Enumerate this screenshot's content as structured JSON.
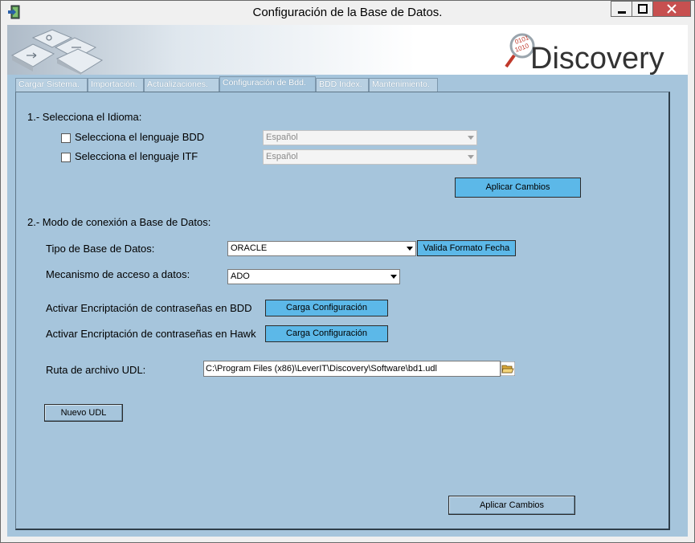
{
  "window": {
    "title": "Configuración de la Base de Datos."
  },
  "banner": {
    "logo_text": "Discovery"
  },
  "tabs": [
    {
      "label": "Cargar Sistema."
    },
    {
      "label": "Importación."
    },
    {
      "label": "Actualizaciones."
    },
    {
      "label": "Configuración de Bdd."
    },
    {
      "label": "BDD Index."
    },
    {
      "label": "Mantenimiento."
    }
  ],
  "section1": {
    "heading": "1.- Selecciona el Idioma:",
    "bdd_label": "Selecciona el lenguaje BDD",
    "bdd_value": "Español",
    "itf_label": "Selecciona el lenguaje ITF",
    "itf_value": "Español",
    "apply_label": "Aplicar Cambios"
  },
  "section2": {
    "heading": "2.- Modo de conexión a Base de Datos:",
    "db_type_label": "Tipo de Base de Datos:",
    "db_type_value": "ORACLE",
    "validate_label": "Valida Formato Fecha",
    "access_label": "Mecanismo de acceso a datos:",
    "access_value": "ADO",
    "enc_bdd_label": "Activar Encriptación de contraseñas en BDD",
    "enc_bdd_button": "Carga Configuración",
    "enc_hawk_label": "Activar Encriptación de contraseñas en Hawk",
    "enc_hawk_button": "Carga Configuración",
    "udl_label": "Ruta de archivo UDL:",
    "udl_value": "C:\\Program Files (x86)\\LeverIT\\Discovery\\Software\\bd1.udl",
    "new_udl_label": "Nuevo UDL",
    "apply_label": "Aplicar Cambios"
  },
  "colors": {
    "panel": "#a6c5dc",
    "button_accent": "#5cb8e8",
    "close": "#c75050"
  }
}
